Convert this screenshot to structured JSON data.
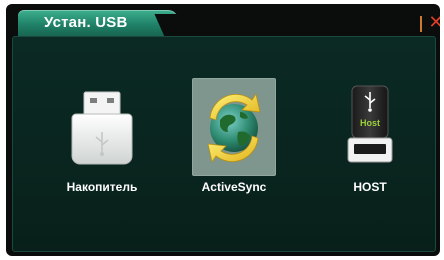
{
  "tab": {
    "title": "Устан. USB"
  },
  "window": {
    "close_glyph": "✕"
  },
  "items": [
    {
      "label": "Накопитель",
      "icon": "usb-flash-drive-icon",
      "selected": false
    },
    {
      "label": "ActiveSync",
      "icon": "sync-globe-icon",
      "selected": true
    },
    {
      "label": "HOST",
      "icon": "usb-host-drive-icon",
      "selected": false,
      "icon_text": "Host"
    }
  ],
  "colors": {
    "tab_green": "#1f7f66",
    "panel_bg": "#0b2a23",
    "selected_bg": "#7f968e",
    "close_red": "#e04028",
    "separator_orange": "#cc7a2b"
  }
}
